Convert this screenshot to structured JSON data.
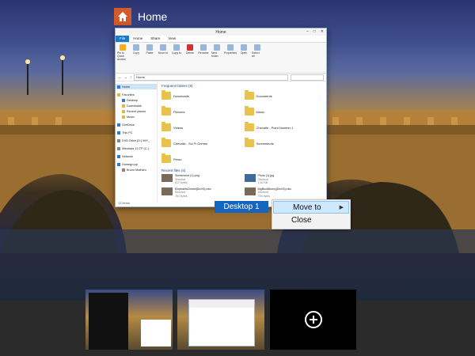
{
  "app": {
    "title": "Home",
    "icon": "home-icon"
  },
  "explorer": {
    "window_title": "Home",
    "controls": [
      "–",
      "□",
      "✕"
    ],
    "tabs": [
      "File",
      "Home",
      "Share",
      "View"
    ],
    "ribbon": [
      {
        "label": "Pin to Quick access",
        "icon": "star-icon"
      },
      {
        "label": "Copy",
        "icon": "copy-icon"
      },
      {
        "label": "Paste",
        "icon": "paste-icon"
      },
      {
        "label": "Move to",
        "icon": "move-icon"
      },
      {
        "label": "Copy to",
        "icon": "copy-to-icon"
      },
      {
        "label": "Delete",
        "icon": "delete-icon"
      },
      {
        "label": "Rename",
        "icon": "rename-icon"
      },
      {
        "label": "New folder",
        "icon": "new-folder-icon"
      },
      {
        "label": "Properties",
        "icon": "properties-icon"
      },
      {
        "label": "Open",
        "icon": "open-icon"
      },
      {
        "label": "Select all",
        "icon": "select-icon"
      }
    ],
    "address": "Home",
    "nav": {
      "home": "Home",
      "favorites": "Favorites",
      "fav_items": [
        "Desktop",
        "Downloads",
        "Recent places",
        "Music"
      ],
      "onedrive": "OneDrive",
      "thispc": "This PC",
      "drive1": "DVD Drive (D:) IMY_",
      "drive2": "Windows 10 TP (C:)",
      "network": "Network",
      "homegroup": "Homegroup",
      "user": "Bruno Mathieu"
    },
    "frequent_header": "Frequent folders (9)",
    "frequent": [
      "Downloads",
      "Documents",
      "Pictures",
      "Music",
      "Videos",
      "Chevalle - Point Number 1",
      "Chevalle - Sci Fi Crimes",
      "Screenshots",
      "Perso"
    ],
    "recent_header": "Recent files (4)",
    "recent": [
      {
        "name": "Screenshot (1).png",
        "type": "Shortcut",
        "size": "817 bytes"
      },
      {
        "name": "Photo (1).jpg",
        "type": "Shortcut",
        "size": "1,52 KB"
      },
      {
        "name": "ElephantsDream[DivX5].mkv",
        "type": "Shortcut",
        "size": "781 bytes"
      },
      {
        "name": "BigBuckBunny[DivX5].mkv",
        "type": "Shortcut",
        "size": "793 bytes"
      }
    ],
    "status": "13 items"
  },
  "desktop_button": "Desktop 1",
  "context_menu": {
    "move_to": "Move to",
    "close": "Close"
  }
}
